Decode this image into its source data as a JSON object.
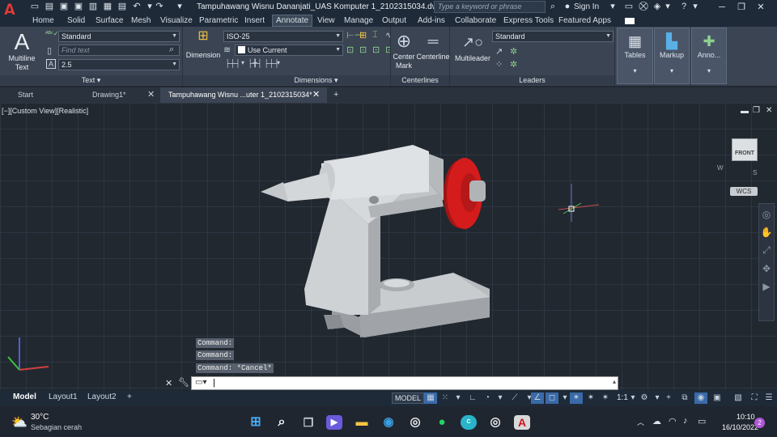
{
  "app": {
    "title": "Tampuhawang Wisnu Dananjati_UAS Komputer 1_2102315034.dwg",
    "logo": "A",
    "search_placeholder": "Type a keyword or phrase",
    "sign_in": "Sign In"
  },
  "menu": [
    "Home",
    "Solid",
    "Surface",
    "Mesh",
    "Visualize",
    "Parametric",
    "Insert",
    "Annotate",
    "View",
    "Manage",
    "Output",
    "Add-ins",
    "Collaborate",
    "Express Tools",
    "Featured Apps"
  ],
  "ribbon": {
    "text": {
      "multiline": "Multiline",
      "multiline2": "Text",
      "style": "Standard",
      "find": "Find text",
      "height": "2.5",
      "label": "Text ▾"
    },
    "dimensions": {
      "big": "Dimension",
      "style": "ISO-25",
      "layer": "Use Current",
      "label": "Dimensions ▾"
    },
    "centerlines": {
      "mark1": "Center",
      "mark2": "Mark",
      "centerline": "Centerline",
      "label": "Centerlines"
    },
    "leaders": {
      "multileader": "Multileader",
      "style": "Standard",
      "label": "Leaders"
    },
    "tables": "Tables",
    "markup": "Markup",
    "anno": "Anno..."
  },
  "tabs": {
    "start": "Start",
    "drawing1": "Drawing1*",
    "current": "Tampuhawang Wisnu ...uter 1_2102315034*"
  },
  "viewport": {
    "label": "[−][Custom View][Realistic]",
    "wcs": "WCS",
    "cube_face": "FRONT",
    "cube_w": "W",
    "cube_s": "S"
  },
  "command": {
    "history": [
      "Command:",
      "Command:",
      "Command: *Cancel*"
    ]
  },
  "status": {
    "tabs": [
      "Model",
      "Layout1",
      "Layout2"
    ],
    "model": "MODEL",
    "scale": "1:1"
  },
  "taskbar": {
    "temp": "30°C",
    "weather": "Sebagian cerah",
    "time": "10:10",
    "date": "16/10/2022",
    "notif": "2"
  },
  "colors": {
    "accent": "#e23a3a",
    "handwheel": "#d41c1c",
    "ribbon": "#3b4453"
  }
}
